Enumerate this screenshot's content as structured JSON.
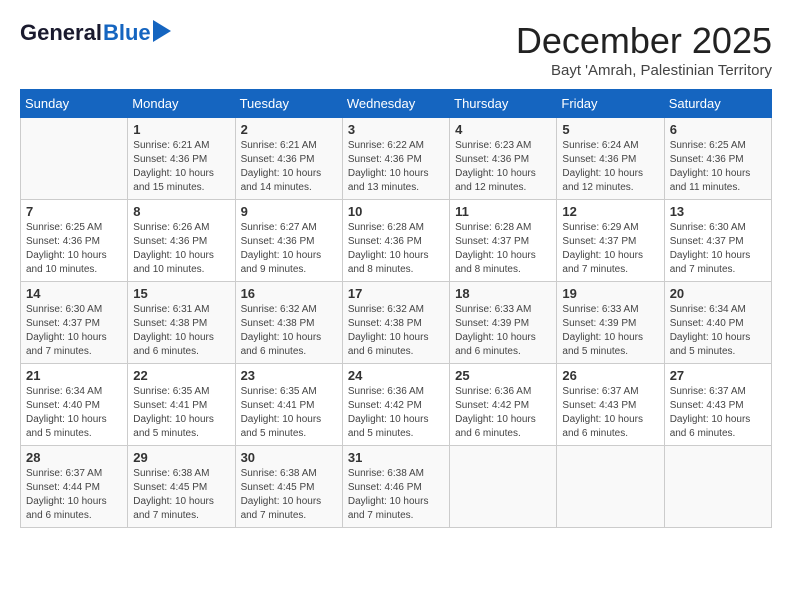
{
  "logo": {
    "general": "General",
    "blue": "Blue"
  },
  "title": "December 2025",
  "location": "Bayt 'Amrah, Palestinian Territory",
  "days_of_week": [
    "Sunday",
    "Monday",
    "Tuesday",
    "Wednesday",
    "Thursday",
    "Friday",
    "Saturday"
  ],
  "weeks": [
    [
      {
        "day": "",
        "info": ""
      },
      {
        "day": "1",
        "info": "Sunrise: 6:21 AM\nSunset: 4:36 PM\nDaylight: 10 hours\nand 15 minutes."
      },
      {
        "day": "2",
        "info": "Sunrise: 6:21 AM\nSunset: 4:36 PM\nDaylight: 10 hours\nand 14 minutes."
      },
      {
        "day": "3",
        "info": "Sunrise: 6:22 AM\nSunset: 4:36 PM\nDaylight: 10 hours\nand 13 minutes."
      },
      {
        "day": "4",
        "info": "Sunrise: 6:23 AM\nSunset: 4:36 PM\nDaylight: 10 hours\nand 12 minutes."
      },
      {
        "day": "5",
        "info": "Sunrise: 6:24 AM\nSunset: 4:36 PM\nDaylight: 10 hours\nand 12 minutes."
      },
      {
        "day": "6",
        "info": "Sunrise: 6:25 AM\nSunset: 4:36 PM\nDaylight: 10 hours\nand 11 minutes."
      }
    ],
    [
      {
        "day": "7",
        "info": "Sunrise: 6:25 AM\nSunset: 4:36 PM\nDaylight: 10 hours\nand 10 minutes."
      },
      {
        "day": "8",
        "info": "Sunrise: 6:26 AM\nSunset: 4:36 PM\nDaylight: 10 hours\nand 10 minutes."
      },
      {
        "day": "9",
        "info": "Sunrise: 6:27 AM\nSunset: 4:36 PM\nDaylight: 10 hours\nand 9 minutes."
      },
      {
        "day": "10",
        "info": "Sunrise: 6:28 AM\nSunset: 4:36 PM\nDaylight: 10 hours\nand 8 minutes."
      },
      {
        "day": "11",
        "info": "Sunrise: 6:28 AM\nSunset: 4:37 PM\nDaylight: 10 hours\nand 8 minutes."
      },
      {
        "day": "12",
        "info": "Sunrise: 6:29 AM\nSunset: 4:37 PM\nDaylight: 10 hours\nand 7 minutes."
      },
      {
        "day": "13",
        "info": "Sunrise: 6:30 AM\nSunset: 4:37 PM\nDaylight: 10 hours\nand 7 minutes."
      }
    ],
    [
      {
        "day": "14",
        "info": "Sunrise: 6:30 AM\nSunset: 4:37 PM\nDaylight: 10 hours\nand 7 minutes."
      },
      {
        "day": "15",
        "info": "Sunrise: 6:31 AM\nSunset: 4:38 PM\nDaylight: 10 hours\nand 6 minutes."
      },
      {
        "day": "16",
        "info": "Sunrise: 6:32 AM\nSunset: 4:38 PM\nDaylight: 10 hours\nand 6 minutes."
      },
      {
        "day": "17",
        "info": "Sunrise: 6:32 AM\nSunset: 4:38 PM\nDaylight: 10 hours\nand 6 minutes."
      },
      {
        "day": "18",
        "info": "Sunrise: 6:33 AM\nSunset: 4:39 PM\nDaylight: 10 hours\nand 6 minutes."
      },
      {
        "day": "19",
        "info": "Sunrise: 6:33 AM\nSunset: 4:39 PM\nDaylight: 10 hours\nand 5 minutes."
      },
      {
        "day": "20",
        "info": "Sunrise: 6:34 AM\nSunset: 4:40 PM\nDaylight: 10 hours\nand 5 minutes."
      }
    ],
    [
      {
        "day": "21",
        "info": "Sunrise: 6:34 AM\nSunset: 4:40 PM\nDaylight: 10 hours\nand 5 minutes."
      },
      {
        "day": "22",
        "info": "Sunrise: 6:35 AM\nSunset: 4:41 PM\nDaylight: 10 hours\nand 5 minutes."
      },
      {
        "day": "23",
        "info": "Sunrise: 6:35 AM\nSunset: 4:41 PM\nDaylight: 10 hours\nand 5 minutes."
      },
      {
        "day": "24",
        "info": "Sunrise: 6:36 AM\nSunset: 4:42 PM\nDaylight: 10 hours\nand 5 minutes."
      },
      {
        "day": "25",
        "info": "Sunrise: 6:36 AM\nSunset: 4:42 PM\nDaylight: 10 hours\nand 6 minutes."
      },
      {
        "day": "26",
        "info": "Sunrise: 6:37 AM\nSunset: 4:43 PM\nDaylight: 10 hours\nand 6 minutes."
      },
      {
        "day": "27",
        "info": "Sunrise: 6:37 AM\nSunset: 4:43 PM\nDaylight: 10 hours\nand 6 minutes."
      }
    ],
    [
      {
        "day": "28",
        "info": "Sunrise: 6:37 AM\nSunset: 4:44 PM\nDaylight: 10 hours\nand 6 minutes."
      },
      {
        "day": "29",
        "info": "Sunrise: 6:38 AM\nSunset: 4:45 PM\nDaylight: 10 hours\nand 7 minutes."
      },
      {
        "day": "30",
        "info": "Sunrise: 6:38 AM\nSunset: 4:45 PM\nDaylight: 10 hours\nand 7 minutes."
      },
      {
        "day": "31",
        "info": "Sunrise: 6:38 AM\nSunset: 4:46 PM\nDaylight: 10 hours\nand 7 minutes."
      },
      {
        "day": "",
        "info": ""
      },
      {
        "day": "",
        "info": ""
      },
      {
        "day": "",
        "info": ""
      }
    ]
  ]
}
